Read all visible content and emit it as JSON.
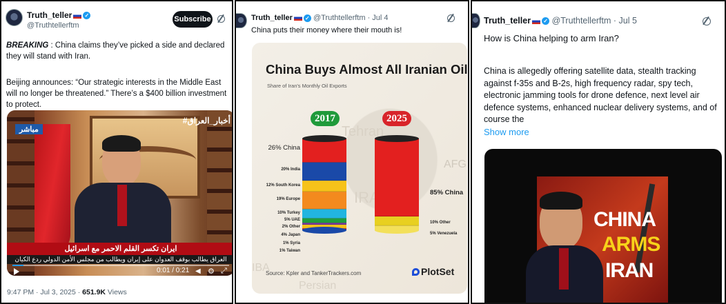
{
  "tweet1": {
    "author": "Truth_teller",
    "handle": "@Truthtellerftm",
    "subscribe": "Subscribe",
    "breaking": "BREAKING",
    "text1": " : China claims they’ve picked a side and declared they will stand with Iran.",
    "text2": "Beijing announces: “Our strategic interests in the Middle East will no longer be threatened.” There’s a $400 billion investment to protect.",
    "video": {
      "channel": "#أخبار_العراق",
      "live": "مباشر",
      "headline": "ايران تكسر القلم الاحمر مع اسرائيل",
      "ticker": "العراق يطالب بوقف العدوان على إيران ويطالب من مجلس الأمن الدولي ردع الكيان",
      "time": "0:01 / 0:21",
      "progress": 0.05
    },
    "meta_time": "9:47 PM · Jul 3, 2025 · ",
    "views": "651.9K",
    "views_label": " Views"
  },
  "tweet2": {
    "author": "Truth_teller",
    "handle": "@Truthtellerftm · Jul 4",
    "text": "China puts their money where their mouth is!",
    "infographic": {
      "title": "China Buys Almost All Iranian Oil",
      "subtitle": "Share of Iran's Monthly Oil Exports",
      "year_a": "2017",
      "year_b": "2025",
      "labels_2017": [
        {
          "label": "26% China",
          "share": 26
        },
        {
          "label": "20% India",
          "share": 20
        },
        {
          "label": "12% South Korea",
          "share": 12
        },
        {
          "label": "19% Europe",
          "share": 19
        },
        {
          "label": "10% Turkey",
          "share": 10
        },
        {
          "label": "5% UAE",
          "share": 5
        },
        {
          "label": "2% Other",
          "share": 2
        },
        {
          "label": "4% Japan",
          "share": 4
        },
        {
          "label": "1% Syria",
          "share": 1
        },
        {
          "label": "1% Taiwan",
          "share": 1
        }
      ],
      "labels_2025": [
        {
          "label": "85% China",
          "share": 85
        },
        {
          "label": "10% Other",
          "share": 10
        },
        {
          "label": "5% Venezuela",
          "share": 5
        }
      ],
      "source": "Source: Kpler and TankerTrackers.com",
      "brand": "PlotSet",
      "map_words": {
        "tehran": "Tehran",
        "iran": "IRA",
        "afg": "AFG",
        "persian": "Persian",
        "iba": "IBA"
      },
      "colors": {
        "red": "#e3201f",
        "blue": "#1a49a8",
        "yellow": "#f6c21a",
        "orange": "#f38a1e",
        "cyan": "#22b5e0",
        "green": "#1f9e3f",
        "purple": "#7c3aa0",
        "year2017": "#1f9a3a",
        "year2025": "#d8242a"
      }
    }
  },
  "tweet3": {
    "author": "Truth_teller",
    "handle": "@Truthtellerftm · Jul 5",
    "question": "How is China helping to arm Iran?",
    "body": "China is allegedly offering satellite data, stealth tracking against f-35s and B-2s, high frequency radar, spy tech, electronic jamming tools for drone defence, next level air defence systems, enhanced nuclear delivery systems, and of course the",
    "show_more": "Show more",
    "thumb": {
      "line1": "CHINA",
      "line2": "ARMS",
      "line3": "IRAN"
    }
  }
}
